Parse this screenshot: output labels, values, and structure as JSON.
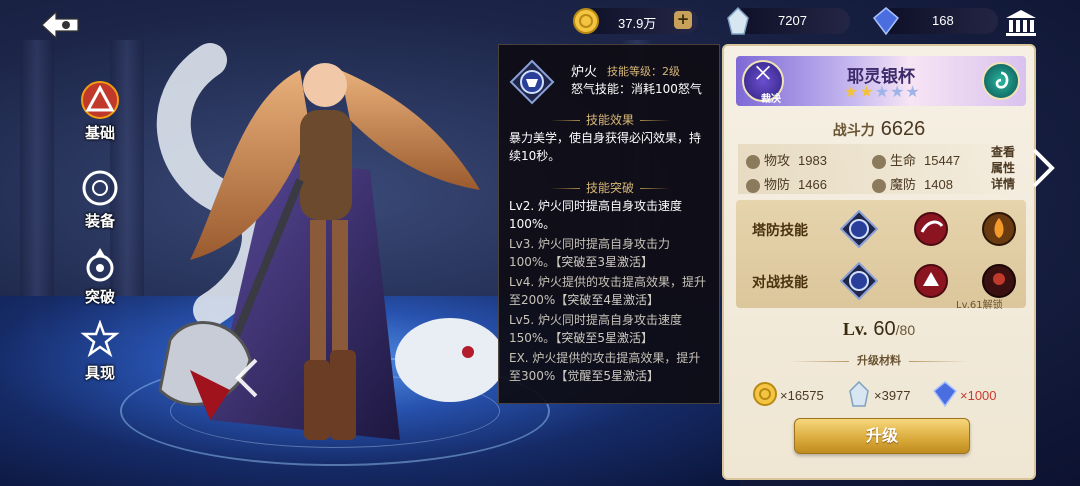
{
  "currency": {
    "gold": {
      "value": "37.9万",
      "icon": "gold-coin-icon"
    },
    "crystal": {
      "value": "7207",
      "icon": "crystal-icon"
    },
    "gem": {
      "value": "168",
      "icon": "blue-gem-icon"
    },
    "plus_symbol": "+"
  },
  "nav": {
    "items": [
      {
        "label": "基础",
        "icon": "triangle-emblem-icon",
        "active": true
      },
      {
        "label": "装备",
        "icon": "equipment-icon",
        "active": false
      },
      {
        "label": "突破",
        "icon": "breakthrough-icon",
        "active": false
      },
      {
        "label": "具现",
        "icon": "manifest-icon",
        "active": false
      }
    ]
  },
  "tooltip": {
    "skill_name": "炉火",
    "skill_level": "技能等级：2级",
    "rage": "怒气技能：消耗100怒气",
    "effect_head": "技能效果",
    "effect_text": "暴力美学，使自身获得必闪效果，持续10秒。",
    "break_head": "技能突破",
    "breaks": [
      {
        "text": "Lv2. 炉火同时提高自身攻击速度100%。",
        "bracket": ""
      },
      {
        "text": "Lv3. 炉火同时提高自身攻击力100%。",
        "bracket": "【突破至3星激活】"
      },
      {
        "text": "Lv4. 炉火提供的攻击提高效果，提升至200%",
        "bracket": "【突破至4星激活】"
      },
      {
        "text": "Lv5. 炉火同时提高自身攻击速度150%。",
        "bracket": "【突破至5星激活】"
      },
      {
        "text": "EX. 炉火提供的攻击提高效果，提升至300%",
        "bracket": "【觉醒至5星激活】"
      }
    ]
  },
  "weapon": {
    "badge": "裁决",
    "name": "耶灵银杯",
    "stars_on": 2,
    "stars_total": 5,
    "star_symbol": "★"
  },
  "power": {
    "label": "战斗力",
    "value": "6626"
  },
  "stats": [
    {
      "label": "物攻",
      "value": "1983"
    },
    {
      "label": "生命",
      "value": "15447"
    },
    {
      "label": "物防",
      "value": "1466"
    },
    {
      "label": "魔防",
      "value": "1408"
    }
  ],
  "detail_button": "查看属性详情",
  "skills": {
    "tower_label": "塔防技能",
    "battle_label": "对战技能",
    "locked_note": "Lv.61解锁"
  },
  "level": {
    "label": "Lv.",
    "current": "60",
    "max": "/80"
  },
  "materials": {
    "head": "升级材料",
    "items": [
      {
        "icon": "gold-coin-icon",
        "value": "×16575",
        "insufficient": false
      },
      {
        "icon": "crystal-icon",
        "value": "×3977",
        "insufficient": false
      },
      {
        "icon": "blue-gem-icon",
        "value": "×1000",
        "insufficient": true
      }
    ]
  },
  "upgrade_button": "升级",
  "colors": {
    "accent_gold": "#d9a93a",
    "panel_bg": "#f6f0e4",
    "shortage_red": "#c93a2e",
    "star_on": "#f3c23b"
  }
}
